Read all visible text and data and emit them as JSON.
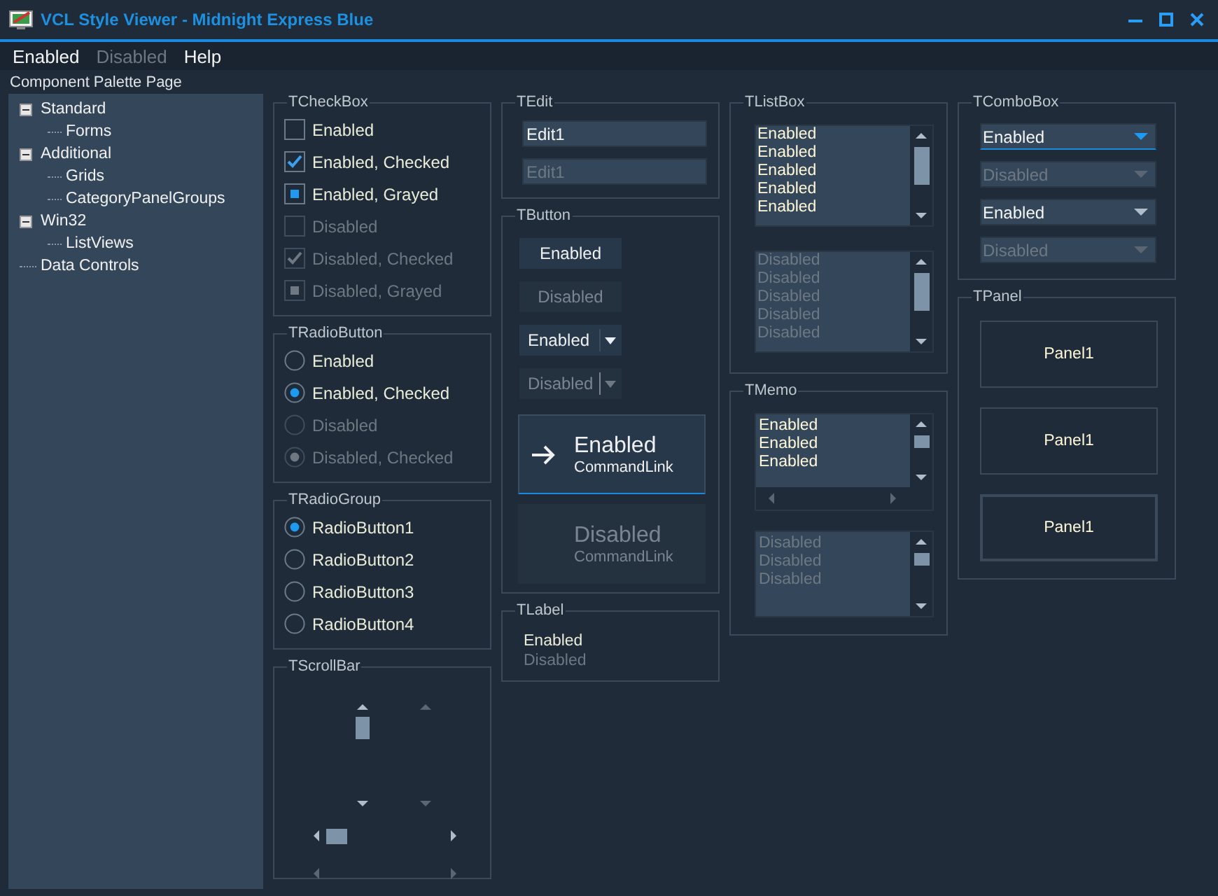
{
  "window": {
    "title": "VCL Style Viewer - Midnight Express Blue"
  },
  "menu": [
    {
      "label": "Enabled",
      "disabled": false
    },
    {
      "label": "Disabled",
      "disabled": true
    },
    {
      "label": "Help",
      "disabled": false
    }
  ],
  "palette_label": "Component Palette Page",
  "tree": [
    {
      "label": "Standard",
      "expanded": true,
      "children": [
        {
          "label": "Forms"
        }
      ]
    },
    {
      "label": "Additional",
      "expanded": true,
      "children": [
        {
          "label": "Grids"
        },
        {
          "label": "CategoryPanelGroups"
        }
      ]
    },
    {
      "label": "Win32",
      "expanded": true,
      "children": [
        {
          "label": "ListViews"
        }
      ]
    },
    {
      "label": "Data Controls"
    }
  ],
  "checkbox_group": {
    "title": "TCheckBox",
    "items": [
      {
        "label": "Enabled",
        "checked": false,
        "grayed": false,
        "disabled": false
      },
      {
        "label": "Enabled, Checked",
        "checked": true,
        "grayed": false,
        "disabled": false
      },
      {
        "label": "Enabled, Grayed",
        "checked": false,
        "grayed": true,
        "disabled": false
      },
      {
        "label": "Disabled",
        "checked": false,
        "grayed": false,
        "disabled": true
      },
      {
        "label": "Disabled, Checked",
        "checked": true,
        "grayed": false,
        "disabled": true
      },
      {
        "label": "Disabled, Grayed",
        "checked": false,
        "grayed": true,
        "disabled": true
      }
    ]
  },
  "radio_button_group": {
    "title": "TRadioButton",
    "items": [
      {
        "label": "Enabled",
        "selected": false,
        "disabled": false
      },
      {
        "label": "Enabled, Checked",
        "selected": true,
        "disabled": false
      },
      {
        "label": "Disabled",
        "selected": false,
        "disabled": true
      },
      {
        "label": "Disabled, Checked",
        "selected": true,
        "disabled": true
      }
    ]
  },
  "radio_group": {
    "title": "TRadioGroup",
    "items": [
      {
        "label": "RadioButton1",
        "selected": true
      },
      {
        "label": "RadioButton2",
        "selected": false
      },
      {
        "label": "RadioButton3",
        "selected": false
      },
      {
        "label": "RadioButton4",
        "selected": false
      }
    ]
  },
  "scrollbar_group": {
    "title": "TScrollBar",
    "vertical_bars": [
      {
        "disabled": false
      },
      {
        "disabled": true
      }
    ],
    "horizontal_bars": [
      {
        "disabled": false
      },
      {
        "disabled": true
      }
    ]
  },
  "edit_group": {
    "title": "TEdit",
    "fields": [
      {
        "value": "Edit1",
        "disabled": false
      },
      {
        "value": "Edit1",
        "disabled": true
      }
    ]
  },
  "button_group": {
    "title": "TButton",
    "buttons": [
      {
        "kind": "push",
        "label": "Enabled",
        "disabled": false
      },
      {
        "kind": "push",
        "label": "Disabled",
        "disabled": true
      },
      {
        "kind": "split",
        "label": "Enabled",
        "disabled": false
      },
      {
        "kind": "split",
        "label": "Disabled",
        "disabled": true
      },
      {
        "kind": "command_link",
        "label": "Enabled",
        "note": "CommandLink",
        "disabled": false
      },
      {
        "kind": "command_link",
        "label": "Disabled",
        "note": "CommandLink",
        "disabled": true
      }
    ]
  },
  "label_group": {
    "title": "TLabel",
    "labels": [
      {
        "text": "Enabled",
        "disabled": false
      },
      {
        "text": "Disabled",
        "disabled": true
      }
    ]
  },
  "listbox_group": {
    "title": "TListBox",
    "lists": [
      {
        "disabled": false,
        "items": [
          "Enabled",
          "Enabled",
          "Enabled",
          "Enabled",
          "Enabled"
        ]
      },
      {
        "disabled": true,
        "items": [
          "Disabled",
          "Disabled",
          "Disabled",
          "Disabled",
          "Disabled"
        ]
      }
    ]
  },
  "memo_group": {
    "title": "TMemo",
    "memos": [
      {
        "disabled": false,
        "horizontal_scrollbar": true,
        "lines": [
          "Enabled",
          "Enabled",
          "Enabled"
        ]
      },
      {
        "disabled": true,
        "horizontal_scrollbar": false,
        "lines": [
          "Disabled",
          "Disabled",
          "Disabled"
        ]
      }
    ]
  },
  "combobox_group": {
    "title": "TComboBox",
    "combos": [
      {
        "value": "Enabled",
        "disabled": false,
        "focused": true
      },
      {
        "value": "Disabled",
        "disabled": true,
        "focused": false
      },
      {
        "value": "Enabled",
        "disabled": false,
        "focused": false
      },
      {
        "value": "Disabled",
        "disabled": true,
        "focused": false
      }
    ]
  },
  "panel_group": {
    "title": "TPanel",
    "panels": [
      {
        "label": "Panel1",
        "kind": "single"
      },
      {
        "label": "Panel1",
        "kind": "single"
      },
      {
        "label": "Panel1",
        "kind": "double"
      }
    ]
  }
}
